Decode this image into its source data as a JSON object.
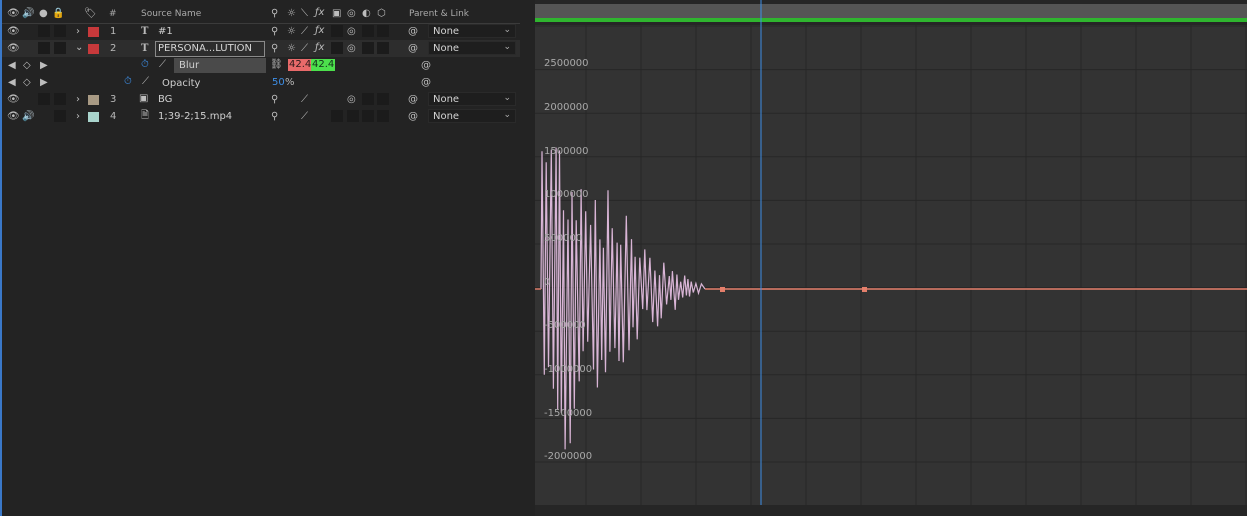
{
  "columns": {
    "number": "#",
    "source_name": "Source Name",
    "parent_link": "Parent & Link"
  },
  "layers": [
    {
      "index": "1",
      "type_icon": "T",
      "name": "#1",
      "color": "#c7393b",
      "parent": "None"
    },
    {
      "index": "2",
      "type_icon": "T",
      "name": "PERSONA...LUTION",
      "color": "#c7393b",
      "parent": "None"
    },
    {
      "index": "3",
      "type_icon": "comp",
      "name": "BG",
      "color": "#a89a84",
      "parent": "None"
    },
    {
      "index": "4",
      "type_icon": "file",
      "name": "1;39-2;15.mp4",
      "color": "#a9d4cc",
      "parent": "None"
    }
  ],
  "properties": {
    "blur": {
      "label": "Blur",
      "value_x": "42.4",
      "value_y": "42.4",
      "x_color": "#e86a6a",
      "y_color": "#4ce04c"
    },
    "opacity": {
      "label": "Opacity",
      "value": "50",
      "unit": "%",
      "value_color": "#3d8ee6"
    }
  },
  "graph": {
    "y_labels": [
      "2500000",
      "2000000",
      "1500000",
      "1000000",
      "500000",
      "0",
      "-500000",
      "-1000000",
      "-1500000",
      "-2000000"
    ],
    "curve_color": "#d9b5d6",
    "flat_line_color": "#e47f6b",
    "playhead_color": "#3d8ee6",
    "work_area_color": "#2fb52f"
  }
}
